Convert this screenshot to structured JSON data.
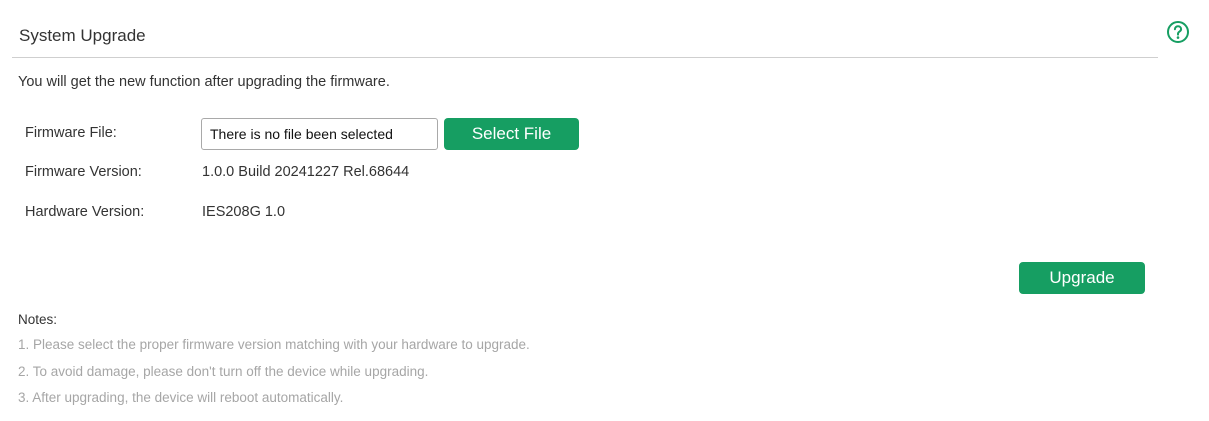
{
  "header": {
    "title": "System Upgrade",
    "help_icon": "help-circle-icon"
  },
  "description": "You will get the new function after upgrading the firmware.",
  "form": {
    "firmware_file_label": "Firmware File:",
    "firmware_file_value": "There is no file been selected",
    "select_file_label": "Select File",
    "firmware_version_label": "Firmware Version:",
    "firmware_version_value": "1.0.0 Build 20241227 Rel.68644",
    "hardware_version_label": "Hardware Version:",
    "hardware_version_value": "IES208G 1.0"
  },
  "actions": {
    "upgrade_label": "Upgrade"
  },
  "notes": {
    "title": "Notes:",
    "items": [
      "1. Please select the proper firmware version matching with your hardware to upgrade.",
      "2. To avoid damage, please don't turn off the device while upgrading.",
      "3. After upgrading, the device will reboot automatically."
    ]
  },
  "colors": {
    "accent": "#169e62",
    "text": "#333333",
    "muted": "#a6a6a6",
    "divider": "#cfcfcf"
  }
}
